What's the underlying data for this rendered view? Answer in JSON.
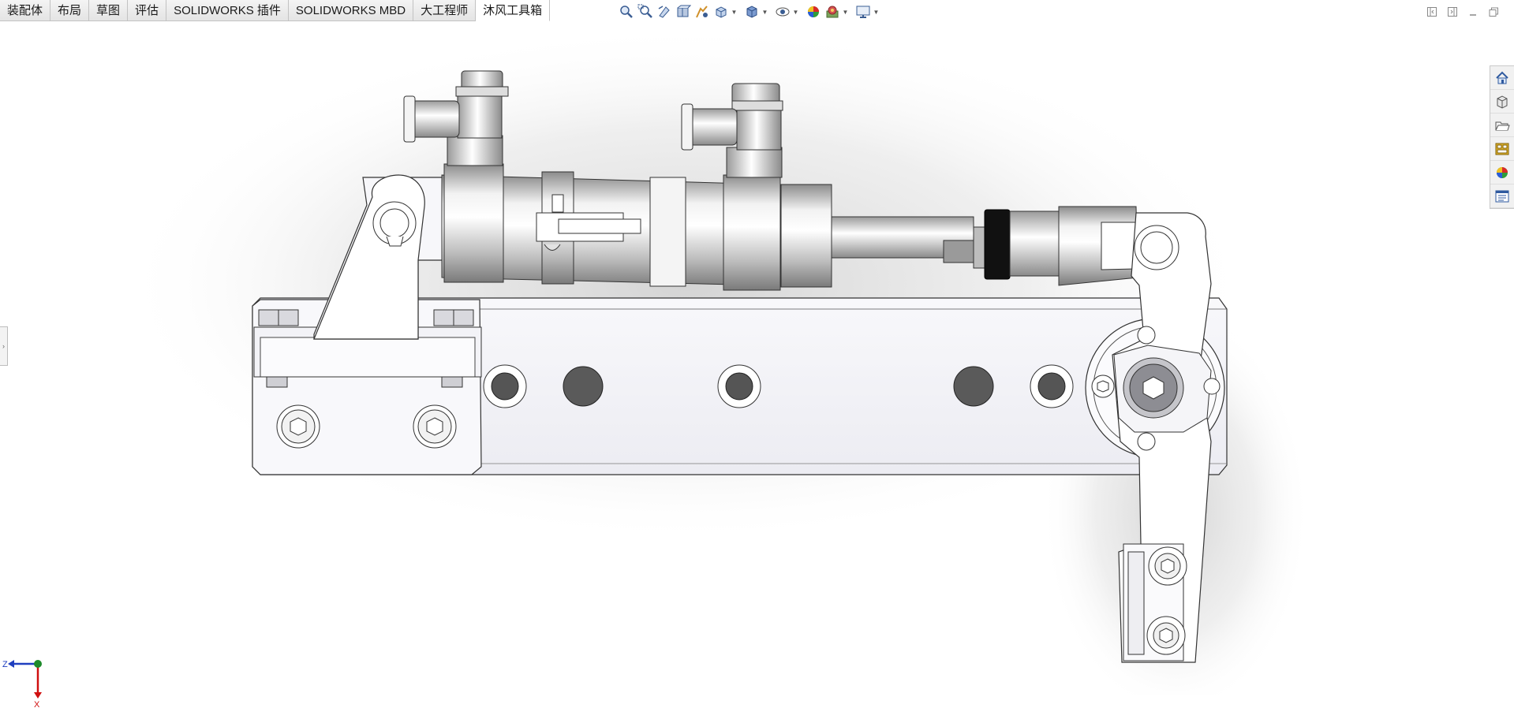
{
  "tabs": [
    {
      "label": "装配体",
      "active": false
    },
    {
      "label": "布局",
      "active": false
    },
    {
      "label": "草图",
      "active": false
    },
    {
      "label": "评估",
      "active": false
    },
    {
      "label": "SOLIDWORKS 插件",
      "active": false
    },
    {
      "label": "SOLIDWORKS MBD",
      "active": false
    },
    {
      "label": "大工程师",
      "active": false
    },
    {
      "label": "沐风工具箱",
      "active": true
    }
  ],
  "hud_icons": [
    "zoom-to-fit-icon",
    "zoom-area-icon",
    "previous-view-icon",
    "section-view-icon",
    "dynamic-annotation-icon",
    "view-orientation-icon",
    "display-style-icon",
    "hide-show-icon",
    "edit-appearance-icon",
    "apply-scene-icon",
    "view-settings-icon"
  ],
  "taskpane_icons": [
    "home-icon",
    "design-library-icon",
    "file-explorer-icon",
    "view-palette-icon",
    "appearances-icon",
    "custom-properties-icon"
  ],
  "triad": {
    "axis_horizontal": "Z",
    "axis_vertical": "X"
  },
  "colors": {
    "accent_blue": "#1f3fbf",
    "accent_red": "#d01010",
    "triad_green": "#1d8a2a"
  }
}
